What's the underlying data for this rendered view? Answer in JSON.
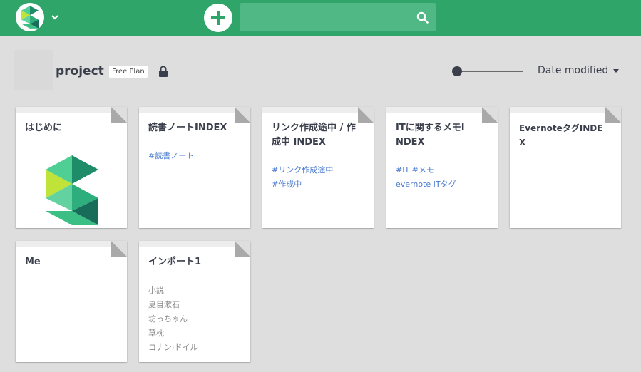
{
  "header": {
    "search": {
      "value": "",
      "placeholder": ""
    },
    "brand_color": "#30a56a"
  },
  "project": {
    "name": "project",
    "plan": "Free Plan"
  },
  "toolbar": {
    "sort_label": "Date modified"
  },
  "pages": [
    {
      "title": "はじめに",
      "links": [],
      "lines": []
    },
    {
      "title": "読書ノートINDEX",
      "links": [
        "#読書ノート"
      ],
      "lines": []
    },
    {
      "title": "リンク作成途中 / 作成中 INDEX",
      "links": [
        "#リンク作成途中",
        "#作成中"
      ],
      "lines": []
    },
    {
      "title": "ITに関するメモINDEX",
      "links": [
        "#IT #メモ",
        "evernote ITタグ"
      ],
      "lines": []
    },
    {
      "title": "EvernoteタグINDEX",
      "links": [],
      "lines": []
    },
    {
      "title": "Me",
      "links": [],
      "lines": []
    },
    {
      "title": "インポート1",
      "links": [],
      "lines": [
        "小説",
        "夏目漱石",
        "坊っちゃん",
        "草枕",
        "コナン·ドイル"
      ]
    }
  ]
}
